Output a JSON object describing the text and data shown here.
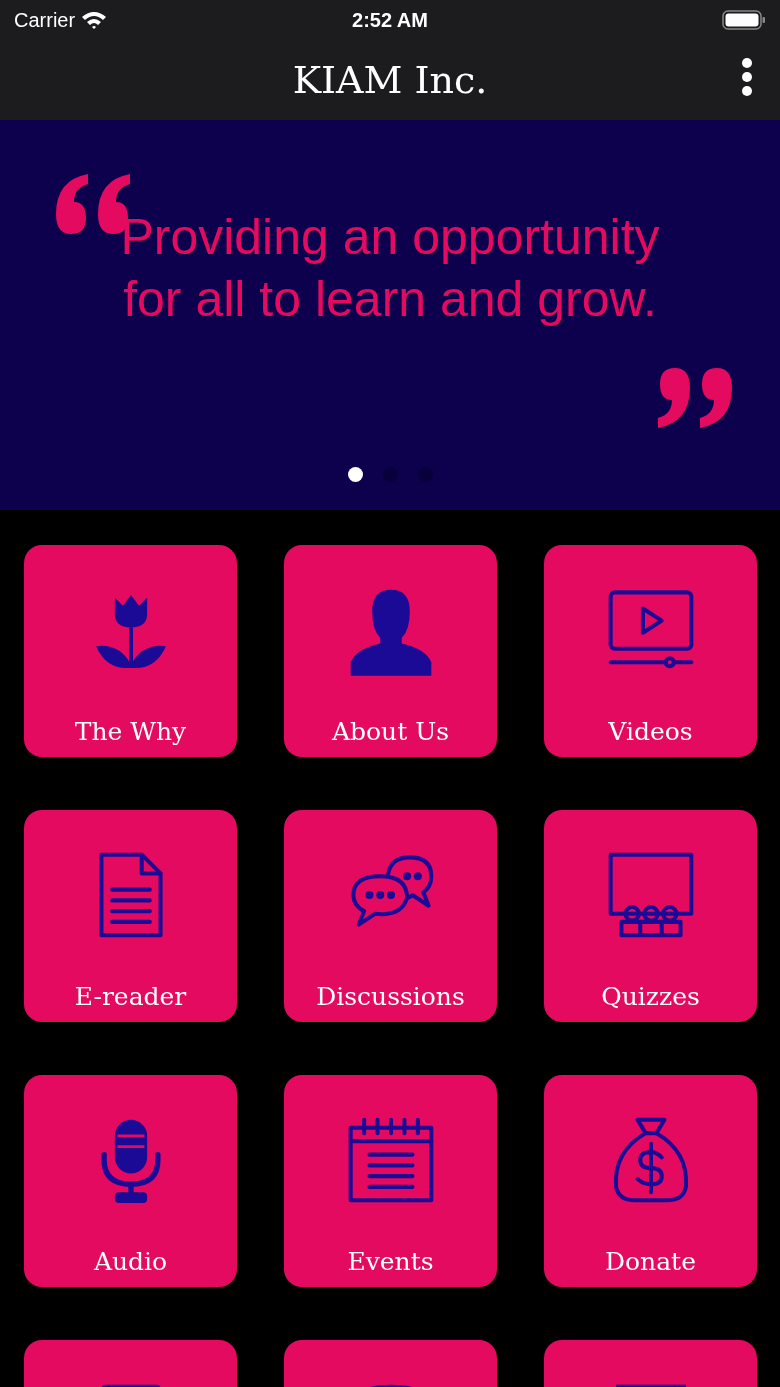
{
  "status_bar": {
    "carrier": "Carrier",
    "time": "2:52 AM"
  },
  "nav_bar": {
    "title": "KIAM Inc."
  },
  "banner": {
    "quote": "Providing an opportunity for all to learn and grow.",
    "dots": [
      {
        "selected": true
      },
      {
        "selected": false
      },
      {
        "selected": false
      }
    ]
  },
  "tiles": [
    {
      "kind": "full",
      "label": "The Why"
    },
    {
      "kind": "full",
      "label": "About Us"
    },
    {
      "kind": "full",
      "label": "Videos"
    },
    {
      "kind": "full",
      "label": "E-reader"
    },
    {
      "kind": "full",
      "label": "Discussions"
    },
    {
      "kind": "full",
      "label": "Quizzes"
    },
    {
      "kind": "full",
      "label": "Audio"
    },
    {
      "kind": "full",
      "label": "Events"
    },
    {
      "kind": "full",
      "label": "Donate"
    },
    {
      "kind": "cut"
    },
    {
      "kind": "cut"
    },
    {
      "kind": "cut"
    }
  ]
}
